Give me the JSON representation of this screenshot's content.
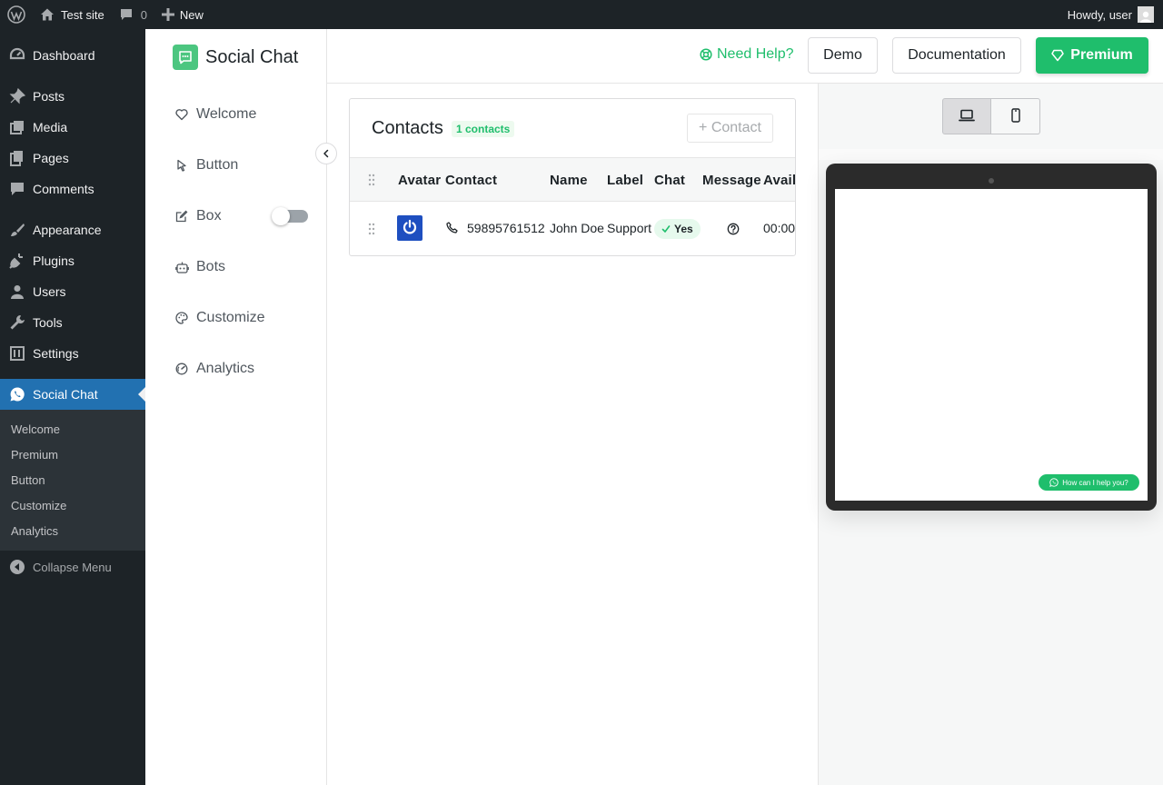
{
  "adminbar": {
    "site_name": "Test site",
    "comments_count": "0",
    "new_label": "New",
    "howdy": "Howdy, user"
  },
  "menu": {
    "items": [
      {
        "label": "Dashboard",
        "icon": "dashboard-icon"
      },
      {
        "label": "Posts",
        "icon": "pin-icon"
      },
      {
        "label": "Media",
        "icon": "media-icon"
      },
      {
        "label": "Pages",
        "icon": "pages-icon"
      },
      {
        "label": "Comments",
        "icon": "comment-icon"
      },
      {
        "label": "Appearance",
        "icon": "brush-icon"
      },
      {
        "label": "Plugins",
        "icon": "plug-icon"
      },
      {
        "label": "Users",
        "icon": "user-icon"
      },
      {
        "label": "Tools",
        "icon": "wrench-icon"
      },
      {
        "label": "Settings",
        "icon": "settings-icon"
      },
      {
        "label": "Social Chat",
        "icon": "whatsapp-icon"
      }
    ],
    "submenu": [
      "Welcome",
      "Premium",
      "Button",
      "Customize",
      "Analytics"
    ],
    "collapse_label": "Collapse Menu"
  },
  "plugin": {
    "brand": "Social Chat",
    "nav": [
      {
        "label": "Welcome",
        "icon": "heart-icon"
      },
      {
        "label": "Button",
        "icon": "cursor-icon"
      },
      {
        "label": "Box",
        "icon": "edit-box-icon",
        "toggle": false
      },
      {
        "label": "Bots",
        "icon": "robot-icon"
      },
      {
        "label": "Customize",
        "icon": "palette-icon"
      },
      {
        "label": "Analytics",
        "icon": "gauge-icon"
      }
    ]
  },
  "header": {
    "help": "Need Help?",
    "demo": "Demo",
    "docs": "Documentation",
    "premium": "Premium"
  },
  "contacts": {
    "title": "Contacts",
    "badge": "1 contacts",
    "add_label": "+ Contact",
    "columns": [
      "Avatar",
      "Contact",
      "Name",
      "Label",
      "Chat",
      "Message",
      "Avail"
    ],
    "rows": [
      {
        "contact": "59895761512",
        "name": "John Doe",
        "label": "Support",
        "chat": "Yes",
        "avail": "00:00"
      }
    ]
  },
  "preview": {
    "chat_button": "How can I help you?"
  },
  "colors": {
    "accent": "#1fbe6c",
    "wp_dark": "#1d2327",
    "wp_blue": "#2271b1"
  }
}
